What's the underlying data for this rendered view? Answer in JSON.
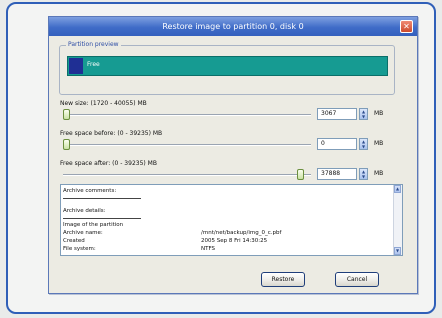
{
  "window": {
    "title": "Restore image to partition 0, disk 0",
    "close_symbol": "✕"
  },
  "preview": {
    "group_label": "Partition preview",
    "partition_label": "Free"
  },
  "new_size": {
    "label": "New size: (1720 - 40055) MB",
    "value": "3067",
    "unit": "MB",
    "slider_fraction": 0.0
  },
  "free_before": {
    "label": "Free space before: (0 - 39235) MB",
    "value": "0",
    "unit": "MB",
    "slider_fraction": 0.0
  },
  "free_after": {
    "label": "Free space after: (0 - 39235) MB",
    "value": "37888",
    "unit": "MB",
    "slider_fraction": 0.97
  },
  "info": {
    "archive_comments": "Archive comments:",
    "archive_details": "Archive details:",
    "image_heading": "Image of the partition",
    "rows": [
      {
        "key": "Archive name:",
        "value": "/mnt/net/backup/img_0_c.pbf"
      },
      {
        "key": "Created",
        "value": "2005 Sep 8 Fri 14:30:25"
      },
      {
        "key": "File system:",
        "value": "NTFS"
      }
    ]
  },
  "buttons": {
    "restore": "Restore",
    "cancel": "Cancel"
  },
  "colors": {
    "titlebar": "#3f6cc8",
    "partition_free": "#169b92",
    "partition_block": "#1f2f94",
    "frame": "#2f5fb8"
  }
}
